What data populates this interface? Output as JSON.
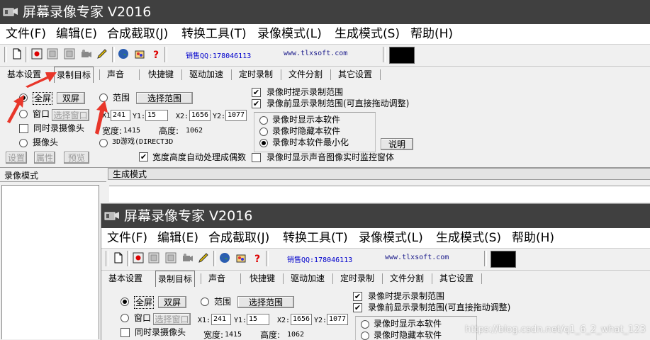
{
  "window": {
    "title": "屏幕录像专家 V2016"
  },
  "menu": [
    "文件(F)",
    "编辑(E)",
    "合成截取(J)",
    "转换工具(T)",
    "录像模式(L)",
    "生成模式(S)",
    "帮助(H)"
  ],
  "toolbar": {
    "sales": "销售QQ:178046113",
    "url": "www.tlxsoft.com"
  },
  "tabs": [
    "基本设置",
    "录制目标",
    "声音",
    "快捷键",
    "驱动加速",
    "定时录制",
    "文件分割",
    "其它设置"
  ],
  "active_tab": "录制目标",
  "record_target": {
    "fullscreen": "全屏",
    "dual": "双屏",
    "window": "窗口",
    "select_window": "选择窗口",
    "webcam_sync": "同时录摄像头",
    "webcam": "摄像头",
    "range": "范围",
    "select_range": "选择范围",
    "x1_label": "X1:",
    "y1_label": "Y1:",
    "x2_label": "X2:",
    "y2_label": "Y2:",
    "x1": "241",
    "y1": "15",
    "x2": "1656",
    "y2": "1077",
    "width_label": "宽度:",
    "width": "1415",
    "height_label": "高度:",
    "height": "1062",
    "game3d": "3D游戏(DIRECT3D",
    "auto_even": "宽度高度自动处理成偶数",
    "btn_settings": "设置",
    "btn_props": "属性",
    "btn_preview": "预览"
  },
  "options": {
    "prompt_range": "录像时提示录制范围",
    "show_range_before": "录像前显示录制范围(可直接拖动调整)",
    "show_software": "录像时显示本软件",
    "hide_software": "录像时隐藏本软件",
    "minimize_software": "录像时本软件最小化",
    "explain": "说明",
    "show_monitor": "录像时显示声音图像实时监控窗体"
  },
  "panels": {
    "record_mode": "录像模式",
    "generate_mode": "生成模式"
  },
  "watermark": "https://blog.csdn.net/q1_6_2_what_123",
  "colors": {
    "titlebar": "#404040",
    "sales_text": "#0000cc",
    "arrow": "#e8362a"
  }
}
